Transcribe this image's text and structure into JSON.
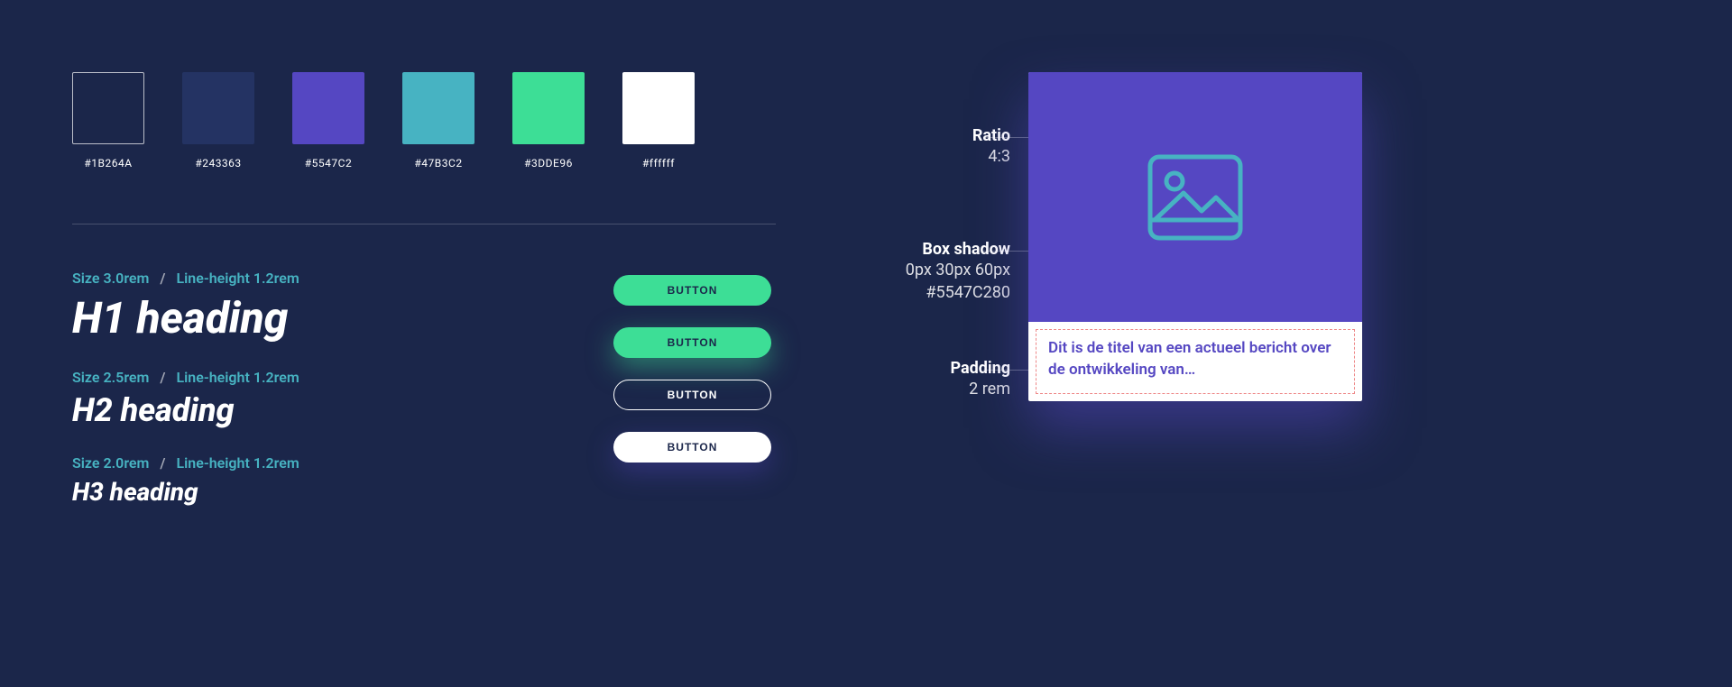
{
  "swatches": [
    {
      "hex": "#1B264A",
      "outlined": true
    },
    {
      "hex": "#243363",
      "outlined": false
    },
    {
      "hex": "#5547C2",
      "outlined": false
    },
    {
      "hex": "#47B3C2",
      "outlined": false
    },
    {
      "hex": "#3DDE96",
      "outlined": false
    },
    {
      "hex": "#ffffff",
      "outlined": false
    }
  ],
  "typography": [
    {
      "size_label": "Size",
      "size": "3.0rem",
      "lh_label": "Line-height",
      "lh": "1.2rem",
      "sample": "H1 heading"
    },
    {
      "size_label": "Size",
      "size": "2.5rem",
      "lh_label": "Line-height",
      "lh": "1.2rem",
      "sample": "H2 heading"
    },
    {
      "size_label": "Size",
      "size": "2.0rem",
      "lh_label": "Line-height",
      "lh": "1.2rem",
      "sample": "H3 heading"
    }
  ],
  "buttons": [
    {
      "label": "BUTTON",
      "variant": "green"
    },
    {
      "label": "BUTTON",
      "variant": "green glow"
    },
    {
      "label": "BUTTON",
      "variant": "outline"
    },
    {
      "label": "BUTTON",
      "variant": "white"
    }
  ],
  "annotations": {
    "ratio": {
      "title": "Ratio",
      "value": "4:3"
    },
    "shadow": {
      "title": "Box shadow",
      "value_1": "0px 30px 60px",
      "value_2": "#5547C280"
    },
    "padding": {
      "title": "Padding",
      "value": "2 rem"
    }
  },
  "card": {
    "title": "Dit is de titel van een actueel bericht over de ontwikkeling van…"
  }
}
